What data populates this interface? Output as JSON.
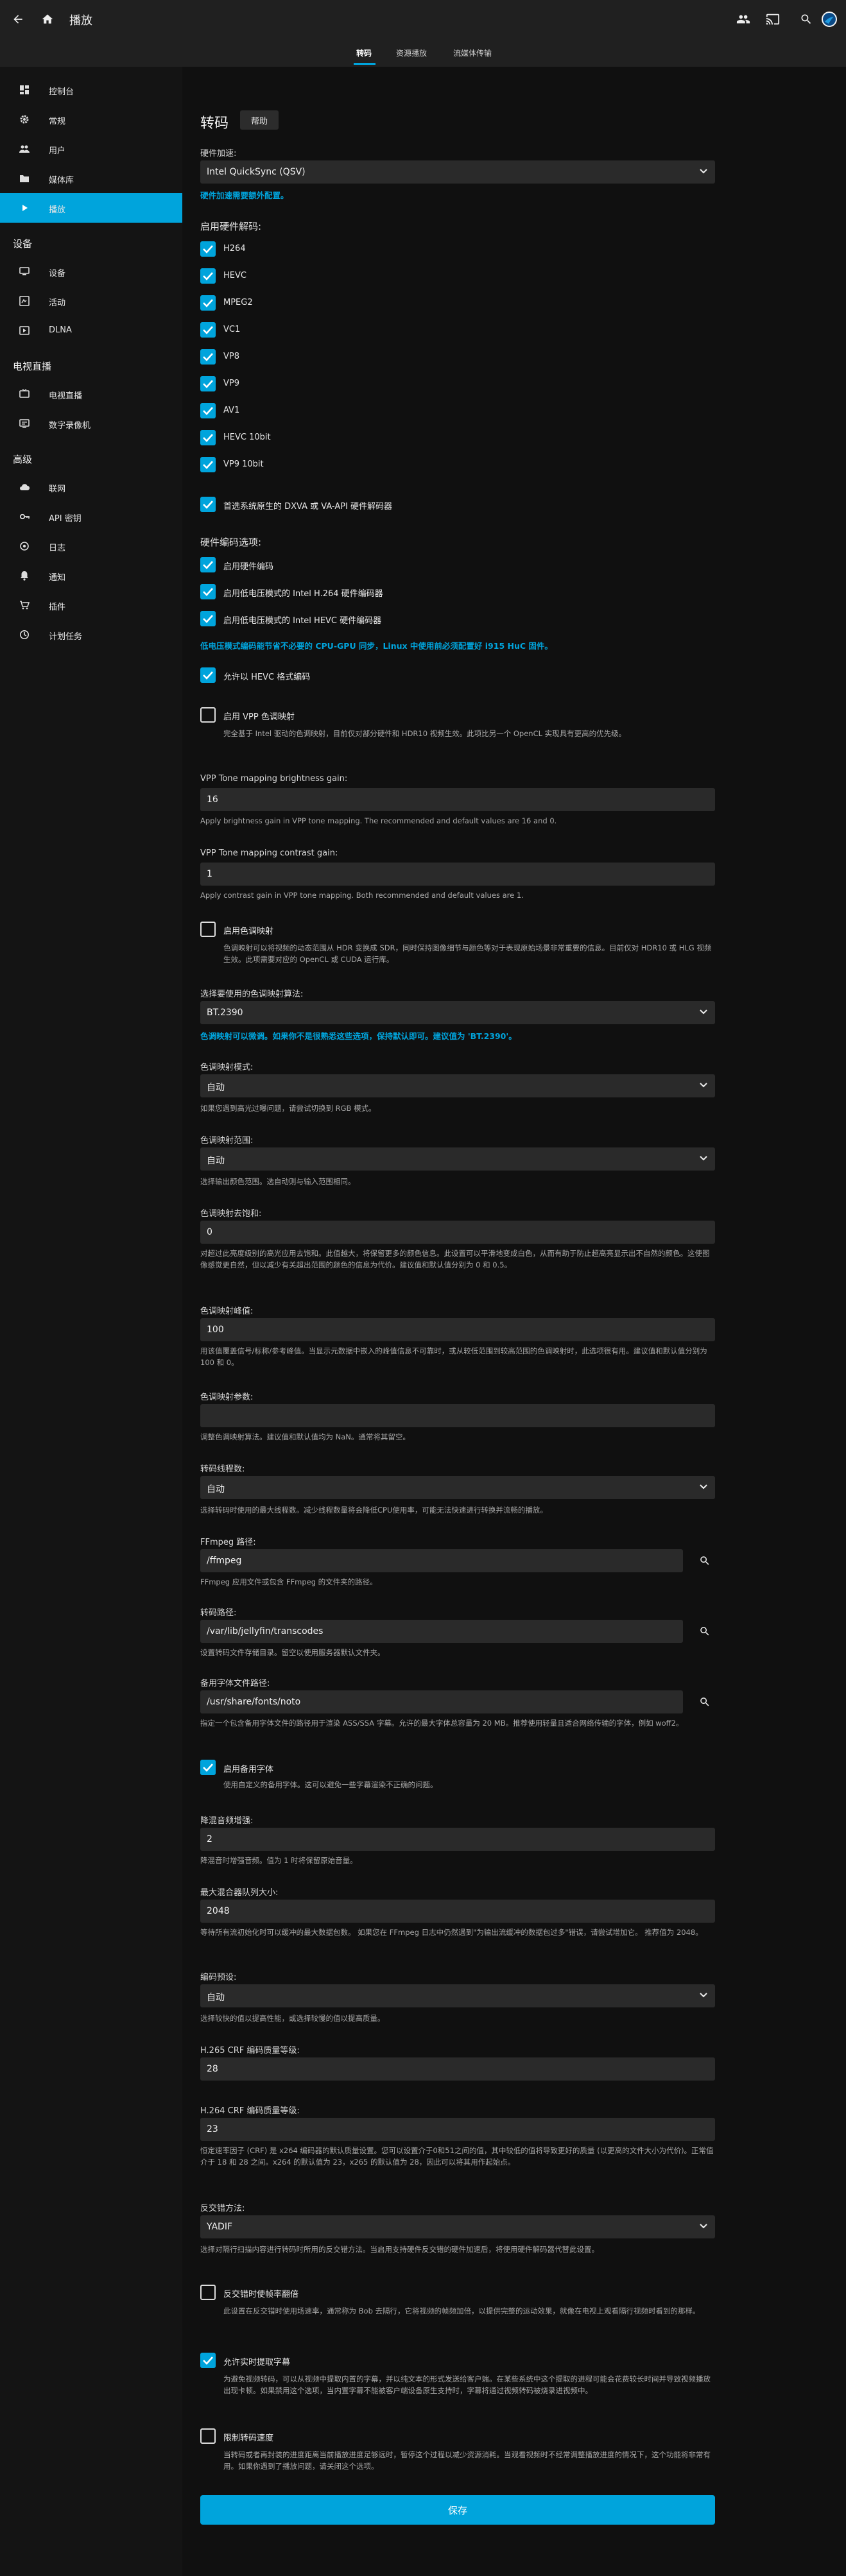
{
  "header": {
    "title": "播放",
    "tabs": [
      {
        "label": "转码",
        "active": true
      },
      {
        "label": "资源播放",
        "active": false
      },
      {
        "label": "流媒体传输",
        "active": false
      }
    ],
    "accent_color": "#00a4dc"
  },
  "sidebar": {
    "top_items": [
      {
        "label": "控制台",
        "icon": "dashboard-icon"
      },
      {
        "label": "常规",
        "icon": "gear-icon"
      },
      {
        "label": "用户",
        "icon": "users-icon"
      },
      {
        "label": "媒体库",
        "icon": "folder-icon"
      },
      {
        "label": "播放",
        "icon": "play-icon",
        "active": true
      }
    ],
    "sections": [
      {
        "title": "设备",
        "items": [
          {
            "label": "设备",
            "icon": "devices-icon"
          },
          {
            "label": "活动",
            "icon": "activity-icon"
          },
          {
            "label": "DLNA",
            "icon": "dlna-icon"
          }
        ]
      },
      {
        "title": "电视直播",
        "items": [
          {
            "label": "电视直播",
            "icon": "tv-icon"
          },
          {
            "label": "数字录像机",
            "icon": "dvr-icon"
          }
        ]
      },
      {
        "title": "高级",
        "items": [
          {
            "label": "联网",
            "icon": "cloud-icon"
          },
          {
            "label": "API 密钥",
            "icon": "key-icon"
          },
          {
            "label": "日志",
            "icon": "log-icon"
          },
          {
            "label": "通知",
            "icon": "bell-icon"
          },
          {
            "label": "插件",
            "icon": "plugin-icon"
          },
          {
            "label": "计划任务",
            "icon": "clock-icon"
          }
        ]
      }
    ]
  },
  "main": {
    "title": "转码",
    "help_label": "帮助",
    "hw_accel": {
      "label": "硬件加速:",
      "value": "Intel QuickSync (QSV)",
      "note": "硬件加速需要额外配置。"
    },
    "hw_decoding": {
      "label": "启用硬件解码:",
      "codecs": [
        {
          "label": "H264",
          "checked": true
        },
        {
          "label": "HEVC",
          "checked": true
        },
        {
          "label": "MPEG2",
          "checked": true
        },
        {
          "label": "VC1",
          "checked": true
        },
        {
          "label": "VP8",
          "checked": true
        },
        {
          "label": "VP9",
          "checked": true
        },
        {
          "label": "AV1",
          "checked": true
        },
        {
          "label": "HEVC 10bit",
          "checked": true
        },
        {
          "label": "VP9 10bit",
          "checked": true
        }
      ],
      "prefer_native": {
        "label": "首选系统原生的 DXVA 或 VA-API 硬件解码器",
        "checked": true
      }
    },
    "hw_encoding": {
      "label": "硬件编码选项:",
      "options": [
        {
          "label": "启用硬件编码",
          "checked": true
        },
        {
          "label": "启用低电压模式的 Intel H.264 硬件编码器",
          "checked": true
        },
        {
          "label": "启用低电压模式的 Intel HEVC 硬件编码器",
          "checked": true
        }
      ],
      "note": "低电压模式编码能节省不必要的 CPU-GPU 同步，Linux 中使用前必须配置好 i915 HuC 固件。"
    },
    "allow_hevc": {
      "label": "允许以 HEVC 格式编码",
      "checked": true
    },
    "vpp_tonemap": {
      "label": "启用 VPP 色调映射",
      "checked": false,
      "help": "完全基于 Intel 驱动的色调映射，目前仅对部分硬件和 HDR10 视频生效。此项比另一个 OpenCL 实现具有更高的优先级。"
    },
    "vpp_brightness": {
      "label": "VPP Tone mapping brightness gain:",
      "value": "16",
      "help": "Apply brightness gain in VPP tone mapping. The recommended and default values are 16 and 0."
    },
    "vpp_contrast": {
      "label": "VPP Tone mapping contrast gain:",
      "value": "1",
      "help": "Apply contrast gain in VPP tone mapping. Both recommended and default values are 1."
    },
    "tonemap": {
      "label": "启用色调映射",
      "checked": false,
      "help": "色调映射可以将视频的动态范围从 HDR 变换成 SDR，同时保持图像细节与颜色等对于表现原始场景非常重要的信息。目前仅对 HDR10 或 HLG 视频生效。此项需要对应的 OpenCL 或 CUDA 运行库。"
    },
    "tonemap_algorithm": {
      "label": "选择要使用的色调映射算法:",
      "value": "BT.2390",
      "note": "色调映射可以微调。如果你不是很熟悉这些选项，保持默认即可。建议值为 'BT.2390'。"
    },
    "tonemap_mode": {
      "label": "色调映射模式:",
      "value": "自动",
      "help": "如果您遇到高光过曝问题，请尝试切换到 RGB 模式。"
    },
    "tonemap_range": {
      "label": "色调映射范围:",
      "value": "自动",
      "help": "选择输出颜色范围。选自动则与输入范围相同。"
    },
    "tonemap_desat": {
      "label": "色调映射去饱和:",
      "value": "0",
      "help": "对超过此亮度级别的高光应用去饱和。此值越大，将保留更多的颜色信息。此设置可以平滑地变成白色，从而有助于防止超高亮显示出不自然的颜色。这使图像感觉更自然，但以减少有关超出范围的颜色的信息为代价。建议值和默认值分别为 0 和 0.5。"
    },
    "tonemap_peak": {
      "label": "色调映射峰值:",
      "value": "100",
      "help": "用该值覆盖信号/标称/参考峰值。当显示元数据中嵌入的峰值信息不可靠时，或从较低范围到较高范围的色调映射时，此选项很有用。建议值和默认值分别为 100 和 0。"
    },
    "tonemap_param": {
      "label": "色调映射参数:",
      "value": "",
      "help": "调整色调映射算法。建议值和默认值均为 NaN。通常将其留空。"
    },
    "thread_count": {
      "label": "转码线程数:",
      "value": "自动",
      "help": "选择转码时使用的最大线程数。减少线程数量将会降低CPU使用率，可能无法快速进行转换并流畅的播放。"
    },
    "ffmpeg_path": {
      "label": "FFmpeg 路径:",
      "value": "/ffmpeg",
      "help": "FFmpeg 应用文件或包含 FFmpeg 的文件夹的路径。"
    },
    "transcode_path": {
      "label": "转码路径:",
      "value": "/var/lib/jellyfin/transcodes",
      "help": "设置转码文件存储目录。留空以使用服务器默认文件夹。"
    },
    "fallback_font_path": {
      "label": "备用字体文件路径:",
      "value": "/usr/share/fonts/noto",
      "help": "指定一个包含备用字体文件的路径用于渲染 ASS/SSA 字幕。允许的最大字体总容量为 20 MB。推荐使用轻量且适合网络传输的字体，例如 woff2。"
    },
    "enable_fallback_font": {
      "label": "启用备用字体",
      "checked": true,
      "help": "使用自定义的备用字体。这可以避免一些字幕渲染不正确的问题。"
    },
    "downmix_boost": {
      "label": "降混音频增强:",
      "value": "2",
      "help": "降混音时增强音频。值为 1 时将保留原始音量。"
    },
    "max_muxing_queue": {
      "label": "最大混合器队列大小:",
      "value": "2048",
      "help": "等待所有流初始化时可以缓冲的最大数据包数。 如果您在 FFmpeg 日志中仍然遇到\"为输出流缓冲的数据包过多\"错误，请尝试增加它。 推荐值为 2048。"
    },
    "encoder_preset": {
      "label": "编码预设:",
      "value": "自动",
      "help": "选择较快的值以提高性能，或选择较慢的值以提高质量。"
    },
    "h265_crf": {
      "label": "H.265 CRF 编码质量等级:",
      "value": "28"
    },
    "h264_crf": {
      "label": "H.264 CRF 编码质量等级:",
      "value": "23",
      "help": "恒定速率因子 (CRF) 是 x264 编码器的默认质量设置。您可以设置介于0和51之间的值，其中较低的值将导致更好的质量 (以更高的文件大小为代价)。正常值介于 18 和 28 之间。x264 的默认值为 23，x265 的默认值为 28，因此可以将其用作起始点。"
    },
    "deinterlace": {
      "label": "反交错方法:",
      "value": "YADIF",
      "help": "选择对隔行扫描内容进行转码时所用的反交错方法。当启用支持硬件反交错的硬件加速后，将使用硬件解码器代替此设置。"
    },
    "double_rate": {
      "label": "反交错时使帧率翻倍",
      "checked": false,
      "help": "此设置在反交错时使用场速率，通常称为 Bob 去隔行，它将视频的帧频加倍，以提供完整的运动效果，就像在电视上观看隔行视频时看到的那样。"
    },
    "subtitle_extraction": {
      "label": "允许实时提取字幕",
      "checked": true,
      "help": "为避免视频转码，可以从视频中提取内置的字幕，并以纯文本的形式发送给客户端。在某些系统中这个提取的进程可能会花费较长时间并导致视频播放出现卡顿。如果禁用这个选项，当内置字幕不能被客户端设备原生支持时，字幕将通过视频转码被烧录进视频中。"
    },
    "throttle": {
      "label": "限制转码速度",
      "checked": false,
      "help": "当转码或者再封装的进度距离当前播放进度足够远时，暂停这个过程以减少资源消耗。当观看视频时不经常调整播放进度的情况下，这个功能将非常有用。如果你遇到了播放问题，请关闭这个选项。"
    },
    "save_label": "保存"
  }
}
